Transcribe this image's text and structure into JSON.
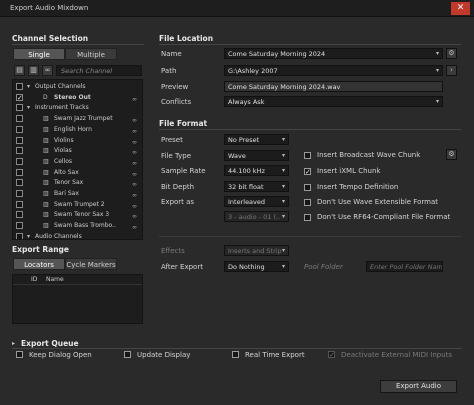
{
  "window": {
    "title": "Export Audio Mixdown",
    "close": "✕"
  },
  "channel_selection": {
    "title": "Channel Selection",
    "tabs": [
      "Single",
      "Multiple"
    ],
    "search_placeholder": "Search Channel",
    "rows": [
      {
        "label": "Output Channels",
        "type": "group",
        "indent": 0,
        "checked": false
      },
      {
        "label": "Stereo Out",
        "type": "channel",
        "indent": 1,
        "checked": true,
        "icon": "D"
      },
      {
        "label": "Instrument Tracks",
        "type": "group",
        "indent": 0,
        "checked": false
      },
      {
        "label": "Swam Jazz Trumpet",
        "type": "channel",
        "indent": 1,
        "checked": false
      },
      {
        "label": "English Horn",
        "type": "channel",
        "indent": 1,
        "checked": false
      },
      {
        "label": "Violins",
        "type": "channel",
        "indent": 1,
        "checked": false
      },
      {
        "label": "Violas",
        "type": "channel",
        "indent": 1,
        "checked": false
      },
      {
        "label": "Cellos",
        "type": "channel",
        "indent": 1,
        "checked": false
      },
      {
        "label": "Alto Sax",
        "type": "channel",
        "indent": 1,
        "checked": false
      },
      {
        "label": "Tenor Sax",
        "type": "channel",
        "indent": 1,
        "checked": false
      },
      {
        "label": "Bari Sax",
        "type": "channel",
        "indent": 1,
        "checked": false
      },
      {
        "label": "Swam Trumpet 2",
        "type": "channel",
        "indent": 1,
        "checked": false
      },
      {
        "label": "Swam Tenor Sax 3",
        "type": "channel",
        "indent": 1,
        "checked": false
      },
      {
        "label": "Swam Bass Trombo..",
        "type": "channel",
        "indent": 1,
        "checked": false
      },
      {
        "label": "Audio Channels",
        "type": "group",
        "indent": 0,
        "checked": false
      }
    ]
  },
  "export_range": {
    "title": "Export Range",
    "tabs": [
      "Locators",
      "Cycle Markers"
    ],
    "columns": [
      "ID",
      "Name"
    ]
  },
  "file_location": {
    "title": "File Location",
    "name_label": "Name",
    "name_value": "Come Saturday Morning 2024",
    "path_label": "Path",
    "path_value": "G:\\Ashley 2007",
    "preview_label": "Preview",
    "preview_value": "Come Saturday Morning 2024.wav",
    "conflicts_label": "Conflicts",
    "conflicts_value": "Always Ask"
  },
  "file_format": {
    "title": "File Format",
    "preset_label": "Preset",
    "preset_value": "No Preset",
    "filetype_label": "File Type",
    "filetype_value": "Wave",
    "samplerate_label": "Sample Rate",
    "samplerate_value": "44.100 kHz",
    "bitdepth_label": "Bit Depth",
    "bitdepth_value": "32 bit float",
    "exportas_label": "Export as",
    "exportas_value": "Interleaved",
    "channel_sub_value": "3 - audio - 01 (..",
    "options": [
      {
        "label": "Insert Broadcast Wave Chunk",
        "checked": false
      },
      {
        "label": "Insert iXML Chunk",
        "checked": true
      },
      {
        "label": "Insert Tempo Definition",
        "checked": false
      },
      {
        "label": "Don't Use Wave Extensible Format",
        "checked": false
      },
      {
        "label": "Don't Use RF64-Compliant File Format",
        "checked": false
      }
    ]
  },
  "effects": {
    "effects_label": "Effects",
    "effects_value": "Inserts and Strip",
    "after_export_label": "After Export",
    "after_export_value": "Do Nothing",
    "pool_folder_label": "Pool Folder",
    "pool_folder_placeholder": "Enter Pool Folder Name"
  },
  "export_queue": {
    "title": "Export Queue",
    "options": [
      {
        "label": "Keep Dialog Open",
        "checked": false
      },
      {
        "label": "Update Display",
        "checked": false
      },
      {
        "label": "Real Time Export",
        "checked": false
      },
      {
        "label": "Deactivate External MIDI Inputs",
        "checked": true,
        "disabled": true
      }
    ],
    "export_button": "Export Audio"
  },
  "icons": {
    "dropdown": "▾",
    "gear": "⚙",
    "chevron_right": "›",
    "check": "✓",
    "link": "∞",
    "expand": "▾",
    "collapse": "▸"
  },
  "colors": {
    "close_button": "#c0392b",
    "background": "#2a2a2a",
    "field": "#1c1c1c"
  }
}
